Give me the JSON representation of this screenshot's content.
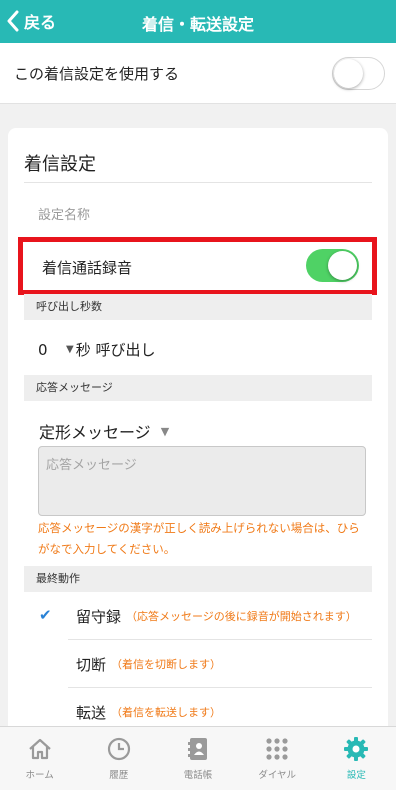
{
  "header": {
    "back_label": "戻る",
    "title": "着信・転送設定"
  },
  "use_setting": {
    "label": "この着信設定を使用する",
    "enabled": false
  },
  "card": {
    "title": "着信設定",
    "setting_name_placeholder": "設定名称",
    "recording": {
      "label": "着信通話録音",
      "enabled": true
    },
    "ring_section": {
      "title": "呼び出し秒数",
      "value": "0",
      "suffix": "秒 呼び出し"
    },
    "message_section": {
      "title": "応答メッセージ",
      "type": "定形メッセージ",
      "placeholder": "応答メッセージ",
      "note": "応答メッセージの漢字が正しく読み上げられない場合は、ひらがなで入力してください。"
    },
    "final_section": {
      "title": "最終動作",
      "options": [
        {
          "label": "留守録",
          "desc": "（応答メッセージの後に録音が開始されます）",
          "selected": true
        },
        {
          "label": "切断",
          "desc": "（着信を切断します）",
          "selected": false
        },
        {
          "label": "転送",
          "desc": "（着信を転送します）",
          "selected": false
        }
      ]
    }
  },
  "tabs": [
    {
      "label": "ホーム",
      "icon": "home-icon",
      "active": false
    },
    {
      "label": "履歴",
      "icon": "clock-icon",
      "active": false
    },
    {
      "label": "電話帳",
      "icon": "phonebook-icon",
      "active": false
    },
    {
      "label": "ダイヤル",
      "icon": "dialpad-icon",
      "active": false
    },
    {
      "label": "設定",
      "icon": "gear-icon",
      "active": true
    }
  ],
  "colors": {
    "header": "#28b9b5",
    "toggle_on": "#4fd265",
    "highlight_border": "#e8141c",
    "note": "#f07a18",
    "check": "#2a82d6"
  }
}
